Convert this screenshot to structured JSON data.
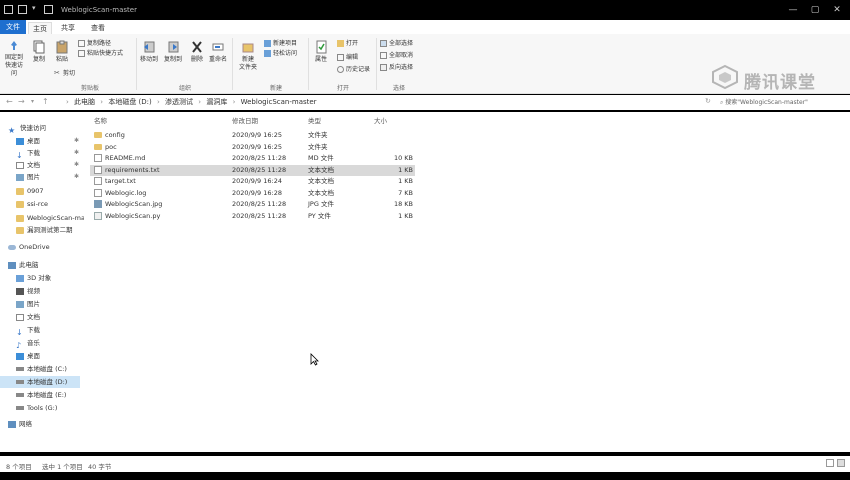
{
  "titlebar": {
    "title": "WeblogicScan-master",
    "min": "—",
    "max": "▢",
    "close": "✕"
  },
  "tabs": [
    {
      "label": "文件"
    },
    {
      "label": "主页"
    },
    {
      "label": "共享"
    },
    {
      "label": "查看"
    }
  ],
  "ribbon": {
    "pin": "固定到快速访问",
    "copy": "复制",
    "paste": "粘贴",
    "copy_path": "复制路径",
    "paste_shortcut": "粘贴快捷方式",
    "cut": "剪切",
    "move_to": "移动到",
    "copy_to": "复制到",
    "delete": "删除",
    "rename": "重命名",
    "new_folder": "新建\n文件夹",
    "new_item": "新建项目",
    "easy_access": "轻松访问",
    "properties": "属性",
    "open": "打开",
    "edit": "编辑",
    "history": "历史记录",
    "select_all": "全部选择",
    "select_none": "全部取消",
    "invert": "反向选择",
    "groups": {
      "clipboard": "剪贴板",
      "organize": "组织",
      "new": "新建",
      "open": "打开",
      "select": "选择"
    },
    "brand": "腾讯课堂"
  },
  "address": {
    "crumbs": [
      "此电脑",
      "本地磁盘 (D:)",
      "渗透测试",
      "漏洞库",
      "WeblogicScan-master"
    ],
    "search_placeholder": "搜索\"WeblogicScan-master\""
  },
  "nav": {
    "items": [
      {
        "label": "快速访问"
      },
      {
        "label": "桌面"
      },
      {
        "label": "下载"
      },
      {
        "label": "文档"
      },
      {
        "label": "图片"
      },
      {
        "label": "0907"
      },
      {
        "label": "ssi-rce"
      },
      {
        "label": "WeblogicScan-ma"
      },
      {
        "label": "漏洞测试第二期"
      },
      {
        "label": "OneDrive"
      },
      {
        "label": "此电脑"
      },
      {
        "label": "3D 对象"
      },
      {
        "label": "视频"
      },
      {
        "label": "图片"
      },
      {
        "label": "文档"
      },
      {
        "label": "下载"
      },
      {
        "label": "音乐"
      },
      {
        "label": "桌面"
      },
      {
        "label": "本地磁盘 (C:)"
      },
      {
        "label": "本地磁盘 (D:)"
      },
      {
        "label": "本地磁盘 (E:)"
      },
      {
        "label": "Tools (G:)"
      },
      {
        "label": "网络"
      }
    ]
  },
  "files": {
    "headers": {
      "name": "名称",
      "date": "修改日期",
      "type": "类型",
      "size": "大小"
    },
    "rows": [
      {
        "name": "config",
        "date": "2020/9/9 16:25",
        "type": "文件夹",
        "size": "",
        "kind": "folder"
      },
      {
        "name": "poc",
        "date": "2020/9/9 16:25",
        "type": "文件夹",
        "size": "",
        "kind": "folder"
      },
      {
        "name": "README.md",
        "date": "2020/8/25 11:28",
        "type": "MD 文件",
        "size": "10 KB",
        "kind": "doc"
      },
      {
        "name": "requirements.txt",
        "date": "2020/8/25 11:28",
        "type": "文本文档",
        "size": "1 KB",
        "kind": "doc"
      },
      {
        "name": "target.txt",
        "date": "2020/9/9 16:24",
        "type": "文本文档",
        "size": "1 KB",
        "kind": "doc"
      },
      {
        "name": "Weblogic.log",
        "date": "2020/9/9 16:28",
        "type": "文本文档",
        "size": "7 KB",
        "kind": "doc"
      },
      {
        "name": "WeblogicScan.jpg",
        "date": "2020/8/25 11:28",
        "type": "JPG 文件",
        "size": "18 KB",
        "kind": "img"
      },
      {
        "name": "WeblogicScan.py",
        "date": "2020/8/25 11:28",
        "type": "PY 文件",
        "size": "1 KB",
        "kind": "py"
      }
    ]
  },
  "status": {
    "count": "8 个项目",
    "selected": "选中 1 个项目",
    "size": "40 字节"
  }
}
